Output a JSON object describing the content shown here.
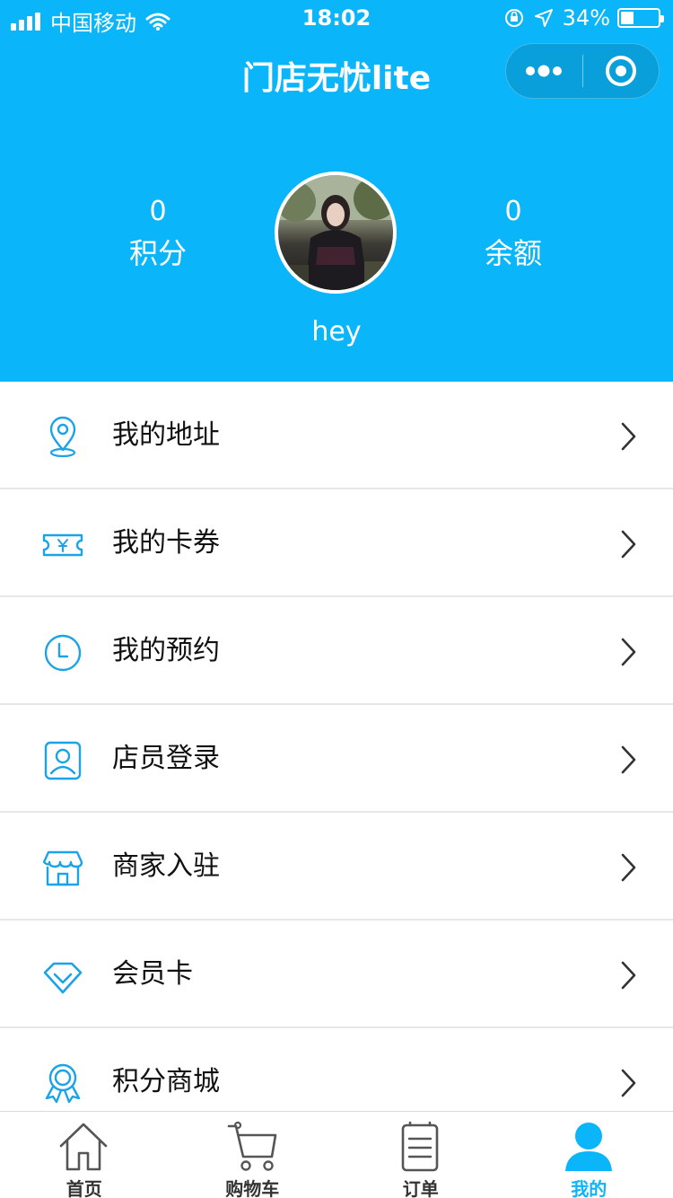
{
  "status_bar": {
    "carrier": "中国移动",
    "time": "18:02",
    "battery_text": "34%",
    "battery_level": 0.34
  },
  "nav": {
    "title": "门店无忧lite"
  },
  "profile": {
    "points_value": "0",
    "points_label": "积分",
    "balance_value": "0",
    "balance_label": "余额",
    "username": "hey"
  },
  "menu": [
    {
      "label": "我的地址",
      "icon": "location-pin-icon"
    },
    {
      "label": "我的卡券",
      "icon": "coupon-ticket-icon"
    },
    {
      "label": "我的预约",
      "icon": "clock-icon"
    },
    {
      "label": "店员登录",
      "icon": "staff-badge-icon"
    },
    {
      "label": "商家入驻",
      "icon": "storefront-icon"
    },
    {
      "label": "会员卡",
      "icon": "diamond-icon"
    },
    {
      "label": "积分商城",
      "icon": "award-ribbon-icon"
    }
  ],
  "tabbar": [
    {
      "label": "首页",
      "icon": "home-icon",
      "active": false
    },
    {
      "label": "购物车",
      "icon": "cart-icon",
      "active": false
    },
    {
      "label": "订单",
      "icon": "order-list-icon",
      "active": false
    },
    {
      "label": "我的",
      "icon": "user-icon",
      "active": true
    }
  ],
  "colors": {
    "primary": "#0bb5fa",
    "icon_blue": "#1aa3e8",
    "text": "#111111",
    "divider": "#e6e6e6"
  }
}
